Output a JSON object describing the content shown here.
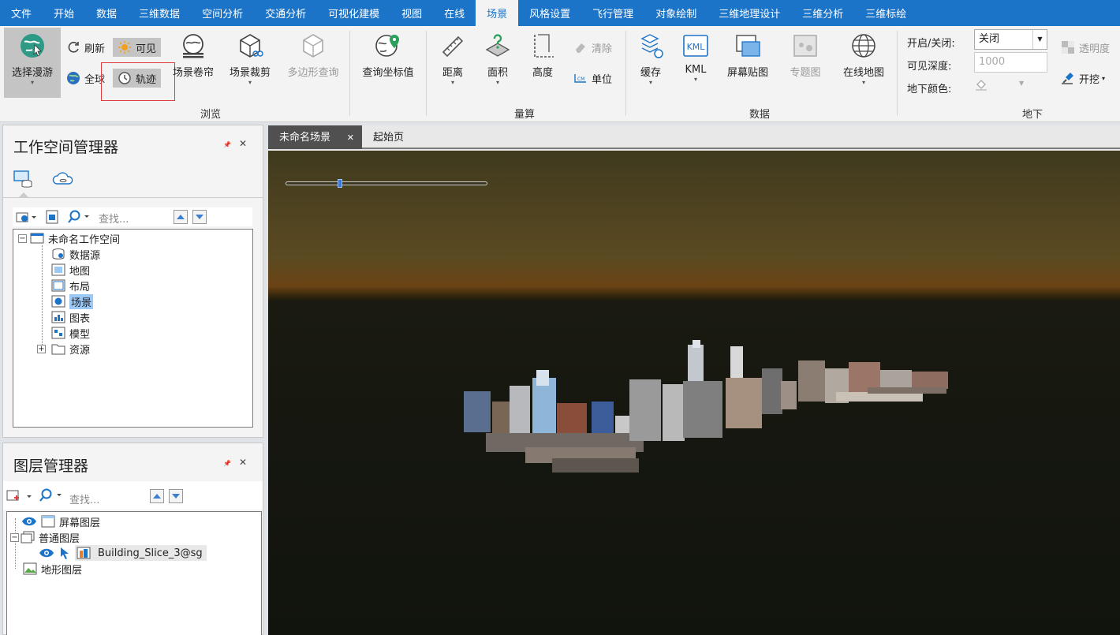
{
  "menu": {
    "tabs": [
      "文件",
      "开始",
      "数据",
      "三维数据",
      "空间分析",
      "交通分析",
      "可视化建模",
      "视图",
      "在线",
      "场景",
      "风格设置",
      "飞行管理",
      "对象绘制",
      "三维地理设计",
      "三维分析",
      "三维标绘"
    ],
    "active": "场景"
  },
  "ribbon": {
    "browse": {
      "roam": "选择漫游",
      "refresh": "刷新",
      "visible": "可见",
      "globe": "全球",
      "track": "轨迹",
      "scene_roller": "场景卷帘",
      "scene_clip": "场景裁剪",
      "polygon_query": "多边形查询",
      "group": "浏览"
    },
    "measure": {
      "query_coord": "查询坐标值",
      "distance": "距离",
      "area": "面积",
      "height": "高度",
      "clear": "清除",
      "unit": "单位",
      "group": "量算"
    },
    "data": {
      "cache": "缓存",
      "kml": "KML",
      "kml_icon_text": "KML",
      "screen_map": "屏幕贴图",
      "thematic": "专题图",
      "online_map": "在线地图",
      "group": "数据"
    },
    "underground": {
      "onoff_label": "开启/关闭:",
      "onoff_value": "关闭",
      "depth_label": "可见深度:",
      "depth_value": "1000",
      "color_label": "地下颜色:",
      "transparency": "透明度",
      "excavate": "开挖",
      "group": "地下"
    }
  },
  "workspace": {
    "title": "工作空间管理器",
    "search_placeholder": "查找...",
    "root": "未命名工作空间",
    "items": [
      "数据源",
      "地图",
      "布局",
      "场景",
      "图表",
      "模型",
      "资源"
    ],
    "selected": "场景"
  },
  "layers": {
    "title": "图层管理器",
    "search_placeholder": "查找...",
    "screen_layer": "屏幕图层",
    "normal_layer": "普通图层",
    "building_layer": "Building_Slice_3@sg",
    "terrain_layer": "地形图层"
  },
  "doc_tabs": {
    "scene_tab": "未命名场景",
    "start_tab": "起始页",
    "close_glyph": "✕"
  },
  "panel_controls": {
    "pin": "📌",
    "close": "✕"
  },
  "colors": {
    "accent": "#1c74c8",
    "selection": "#9cc8f5",
    "highlight_border": "#e23b3b"
  },
  "scene": {
    "slider_level": 0.26
  }
}
